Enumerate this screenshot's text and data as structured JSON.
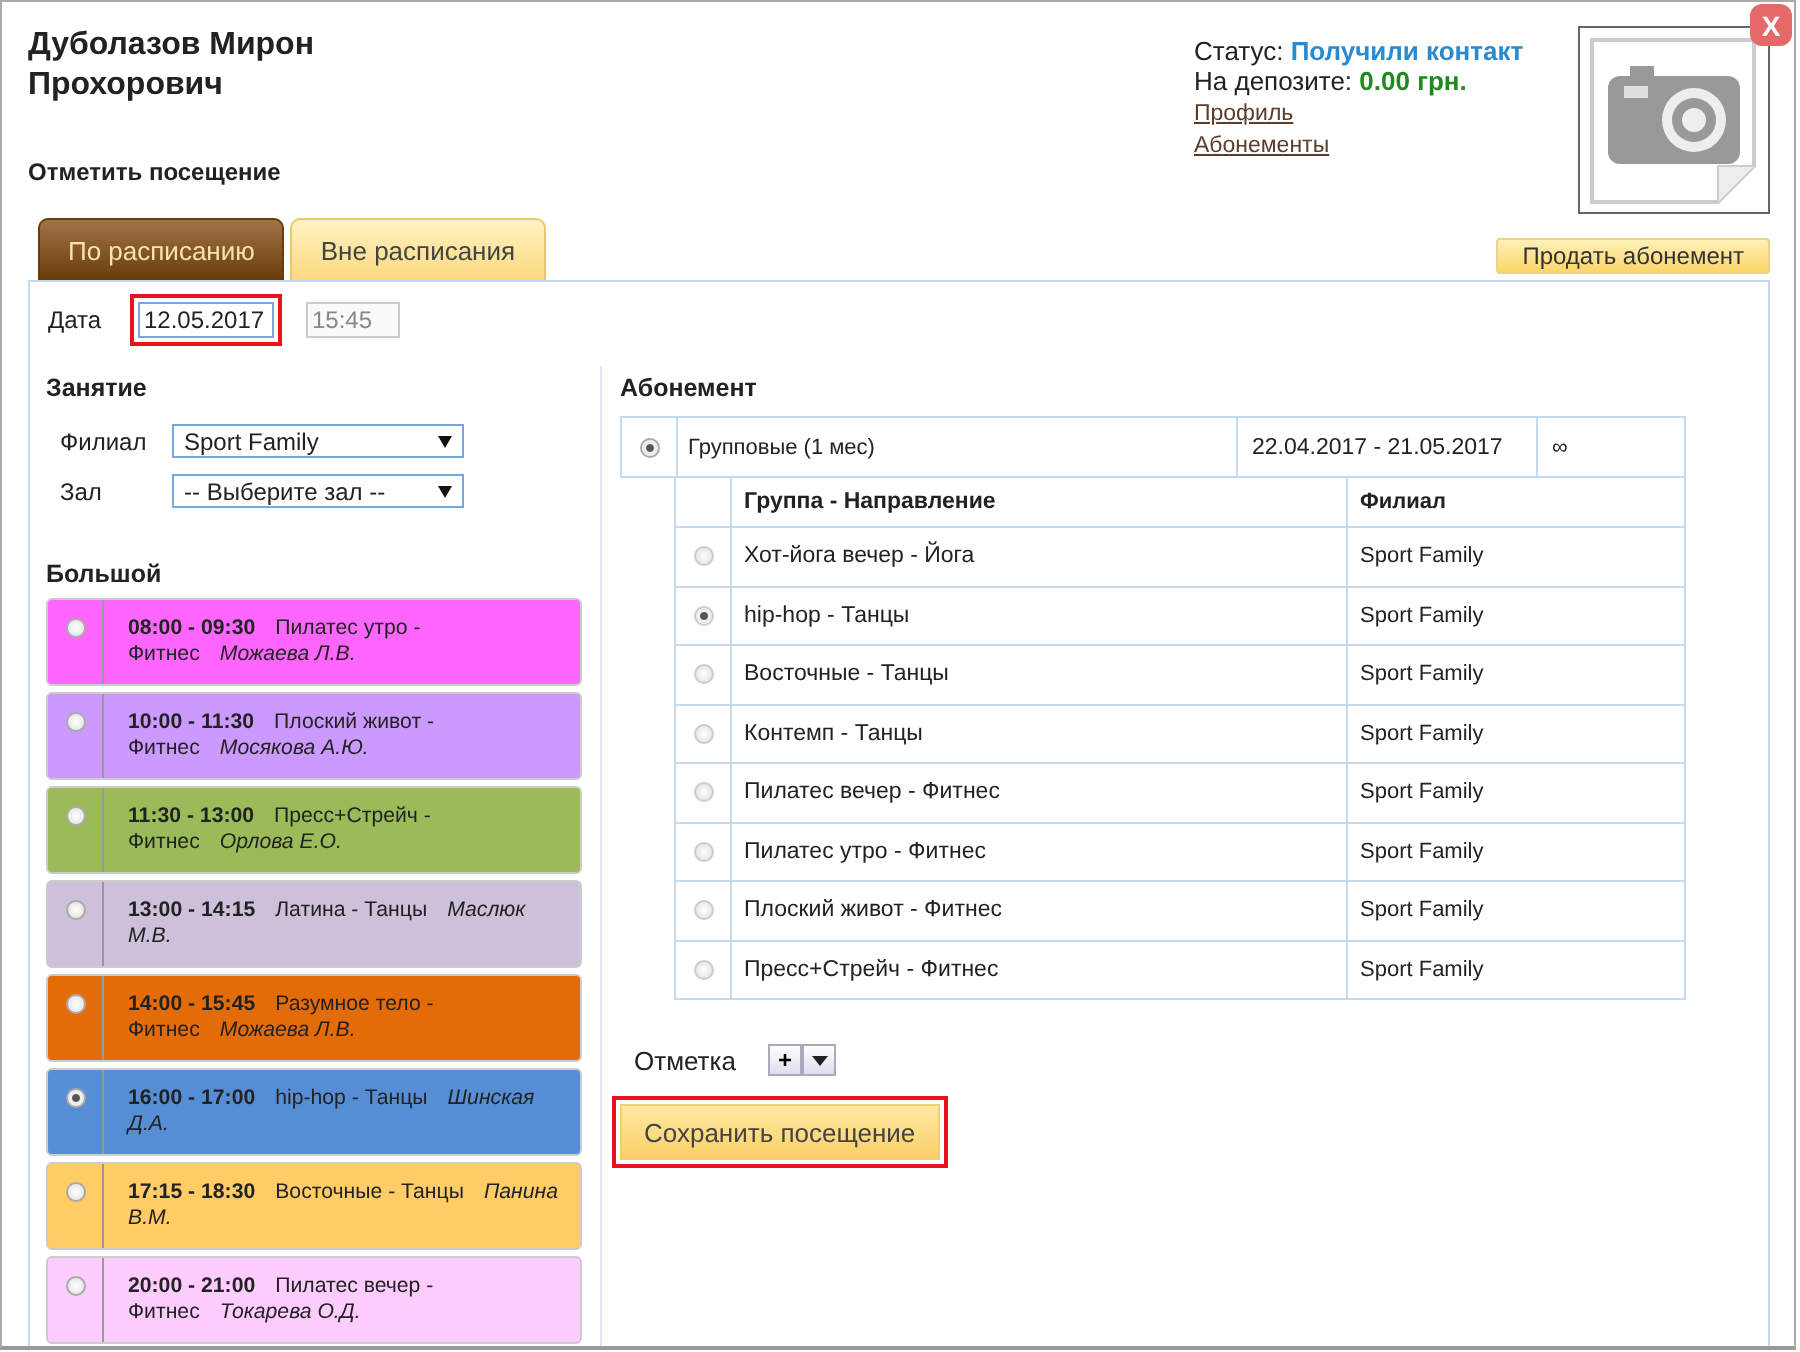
{
  "client": {
    "name": "Дуболазов Мирон Прохорович",
    "status_label": "Статус:",
    "status": "Получили контакт",
    "deposit_label": "На депозите:",
    "deposit": "0.00 грн.",
    "links": [
      "Профиль",
      "Абонементы"
    ]
  },
  "close_button": "X",
  "section_title": "Отметить посещение",
  "tabs": [
    {
      "label": "По расписанию",
      "selected": true
    },
    {
      "label": "Вне расписания",
      "selected": false
    }
  ],
  "sell_button": "Продать абонемент",
  "date": {
    "label": "Дата",
    "value": "12.05.2017",
    "highlighted": true
  },
  "time": {
    "value": "15:45",
    "disabled": true
  },
  "lesson": {
    "title": "Занятие",
    "fields": [
      {
        "label": "Филиал",
        "value": "Sport Family"
      },
      {
        "label": "Зал",
        "value": "-- Выберите зал --"
      }
    ],
    "hall": "Большой",
    "sessions": [
      {
        "time": "08:00 - 09:30",
        "title": "Пилатес утро - Фитнес",
        "teacher": "Можаева Л.В.",
        "color": "#ff66ff",
        "selected": false
      },
      {
        "time": "10:00 - 11:30",
        "title": "Плоский живот - Фитнес",
        "teacher": "Мосякова А.Ю.",
        "color": "#cc99ff",
        "selected": false
      },
      {
        "time": "11:30 - 13:00",
        "title": "Пресс+Стрейч - Фитнес",
        "teacher": "Орлова Е.О.",
        "color": "#9bbb59",
        "selected": false
      },
      {
        "time": "13:00 - 14:15",
        "title": "Латина - Танцы",
        "teacher": "Маслюк М.В.",
        "color": "#ccc0da",
        "selected": false
      },
      {
        "time": "14:00 - 15:45",
        "title": "Разумное тело - Фитнес",
        "teacher": "Можаева Л.В.",
        "color": "#e36c09",
        "selected": false
      },
      {
        "time": "16:00 - 17:00",
        "title": "hip-hop - Танцы",
        "teacher": "Шинская Д.А.",
        "color": "#558ed5",
        "selected": true
      },
      {
        "time": "17:15 - 18:30",
        "title": "Восточные - Танцы",
        "teacher": "Панина В.М.",
        "color": "#ffcc66",
        "selected": false
      },
      {
        "time": "20:00 - 21:00",
        "title": "Пилатес вечер - Фитнес",
        "teacher": "Токарева О.Д.",
        "color": "#ffccff",
        "selected": false
      }
    ]
  },
  "subscription": {
    "title": "Абонемент",
    "plan": {
      "name": "Групповые (1 мес)",
      "period": "22.04.2017 - 21.05.2017",
      "remaining": "∞",
      "selected": true
    },
    "columns": [
      "Группа - Направление",
      "Филиал"
    ],
    "groups": [
      {
        "name": "Хот-йога вечер - Йога",
        "branch": "Sport Family",
        "selected": false
      },
      {
        "name": "hip-hop - Танцы",
        "branch": "Sport Family",
        "selected": true
      },
      {
        "name": "Восточные - Танцы",
        "branch": "Sport Family",
        "selected": false
      },
      {
        "name": "Контемп - Танцы",
        "branch": "Sport Family",
        "selected": false
      },
      {
        "name": "Пилатес вечер - Фитнес",
        "branch": "Sport Family",
        "selected": false
      },
      {
        "name": "Пилатес утро - Фитнес",
        "branch": "Sport Family",
        "selected": false
      },
      {
        "name": "Плоский живот - Фитнес",
        "branch": "Sport Family",
        "selected": false
      },
      {
        "name": "Пресс+Стрейч - Фитнес",
        "branch": "Sport Family",
        "selected": false
      }
    ]
  },
  "mark": {
    "label": "Отметка",
    "add": "+"
  },
  "save_button": {
    "label": "Сохранить посещение",
    "highlighted": true
  }
}
